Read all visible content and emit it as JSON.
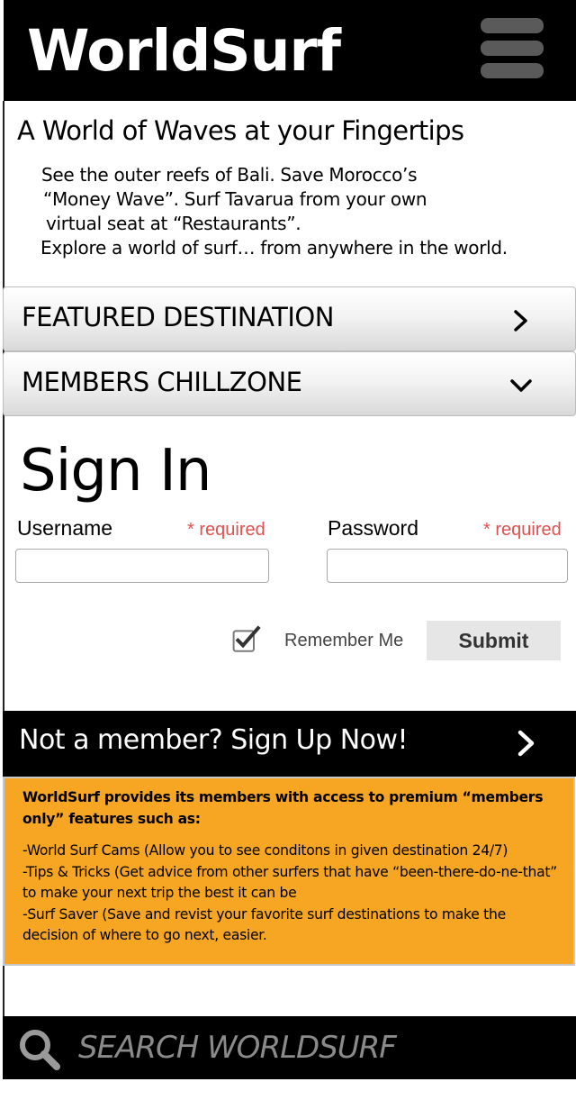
{
  "header": {
    "logo": "WorldSurf",
    "menu_icon": "hamburger-menu-icon"
  },
  "hero": {
    "tagline": "A World of Waves at your Fingertips",
    "lines": [
      "See the outer reefs of Bali. Save Morocco’s",
      "“Money Wave”. Surf Tavarua from your own",
      "virtual seat at “Restaurants”.",
      "Explore a world of surf… from anywhere in the world."
    ]
  },
  "sections": {
    "featured": {
      "label": "FEATURED DESTINATION",
      "icon": "chevron-right-icon"
    },
    "members": {
      "label": "MEMBERS CHILLZONE",
      "icon": "chevron-down-icon"
    }
  },
  "signin": {
    "title": "Sign In",
    "username_label": "Username",
    "username_value": "",
    "password_label": "Password",
    "password_value": "",
    "required_text": "* required",
    "remember_label": "Remember Me",
    "remember_checked": true,
    "submit_label": "Submit"
  },
  "signup": {
    "label": "Not a member? Sign Up Now!",
    "icon": "chevron-right-icon"
  },
  "benefits": {
    "intro": "WorldSurf provides its members with access to premium “members only” features such as:",
    "items": [
      "-World Surf Cams (Allow you to see conditons in given destination 24/7)",
      "-Tips & Tricks (Get advice from other surfers that have “been-there-do-ne-that” to make your next trip the best it can be",
      "-Surf Saver (Save and revist your favorite surf destinations to make the decision of where to go next, easier."
    ]
  },
  "search": {
    "placeholder": "SEARCH WORLDSURF",
    "icon": "search-icon"
  },
  "colors": {
    "header_bg": "#000000",
    "accent_orange": "#f6a623",
    "required_red": "#e05050",
    "menu_gray": "#5a5a5a"
  }
}
